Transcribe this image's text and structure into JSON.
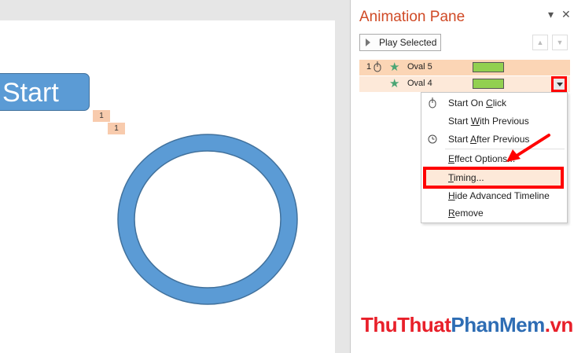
{
  "slide": {
    "start_label": "Start",
    "tags": [
      "1",
      "1"
    ]
  },
  "pane": {
    "title": "Animation Pane",
    "dropdown_glyph": "▾",
    "close_glyph": "✕",
    "play_selected": "Play Selected",
    "move_up_glyph": "▲",
    "move_down_glyph": "▼",
    "items": [
      {
        "number": "1",
        "name": "Oval 5"
      },
      {
        "number": "",
        "name": "Oval 4"
      }
    ]
  },
  "menu": {
    "items": [
      {
        "pre": "Start On ",
        "u": "C",
        "post": "lick"
      },
      {
        "pre": "Start ",
        "u": "W",
        "post": "ith Previous"
      },
      {
        "pre": "Start ",
        "u": "A",
        "post": "fter Previous"
      },
      {
        "pre": "",
        "u": "E",
        "post": "ffect Options..."
      },
      {
        "pre": "",
        "u": "T",
        "post": "iming..."
      },
      {
        "pre": "",
        "u": "H",
        "post": "ide Advanced Timeline"
      },
      {
        "pre": "",
        "u": "R",
        "post": "emove"
      }
    ]
  },
  "watermark": {
    "part1": "ThuThuat",
    "part2": "PhanMem",
    "part3": ".vn"
  },
  "colors": {
    "accent": "#d04a26",
    "shape_fill": "#5b9bd5",
    "highlight": "#ff0000",
    "timing_bar": "#92d050"
  }
}
